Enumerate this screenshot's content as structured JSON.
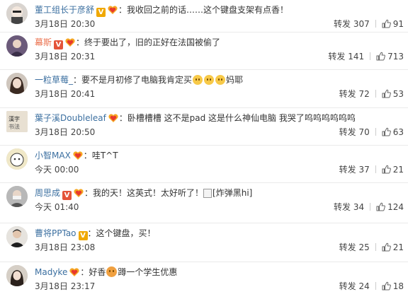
{
  "labels": {
    "repost": "转发"
  },
  "comments": [
    {
      "user": "董工组长于彦舒",
      "text": "我收回之前的话……这个键盘支架有点香！",
      "time": "3月18日 20:30",
      "reposts": "307",
      "likes": "91"
    },
    {
      "user": "幕斯",
      "text": "终于要出了，旧的正好在法国被偷了",
      "time": "3月18日 20:31",
      "reposts": "141",
      "likes": "713"
    },
    {
      "user": "一粒草莓_",
      "text": "要不是月初修了电脑我肯定买",
      "text2": "妈耶",
      "time": "3月18日 20:41",
      "reposts": "72",
      "likes": "53"
    },
    {
      "user": "葉子溪Doubleleaf",
      "text": "卧槽槽槽 这不是pad 这是什么神仙电脑 我哭了呜呜呜呜呜呜",
      "time": "3月18日 20:50",
      "reposts": "70",
      "likes": "63"
    },
    {
      "user": "小智MAX",
      "text": "哇T^T",
      "time": "今天 00:00",
      "reposts": "37",
      "likes": "21"
    },
    {
      "user": "周思成",
      "text": "我的天！这英式！太好听了！",
      "img_alt": "[炸弹黑hi]",
      "time": "今天 01:40",
      "reposts": "34",
      "likes": "124"
    },
    {
      "user": "曹将PPTao",
      "text": "这个键盘，买！",
      "time": "3月18日 23:08",
      "reposts": "25",
      "likes": "21"
    },
    {
      "user": "Madyke",
      "text": "好香",
      "text2": "蹲一个学生优惠",
      "time": "3月18日 23:17",
      "reposts": "24",
      "likes": "18"
    }
  ]
}
